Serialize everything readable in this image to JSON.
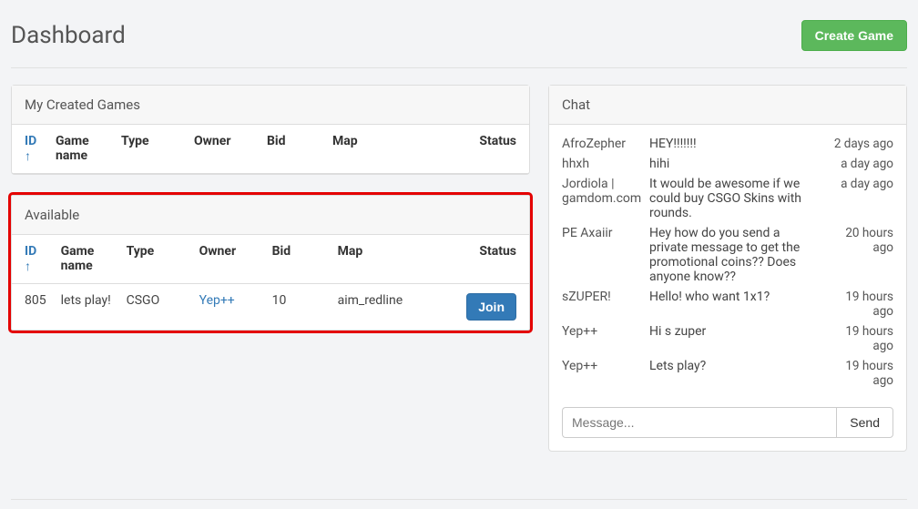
{
  "header": {
    "title": "Dashboard",
    "create_button": "Create Game"
  },
  "my_games_panel": {
    "heading": "My Created Games",
    "columns": {
      "id": "ID ↑",
      "game_name": "Game name",
      "type": "Type",
      "owner": "Owner",
      "bid": "Bid",
      "map": "Map",
      "status": "Status"
    }
  },
  "available_panel": {
    "heading": "Available",
    "columns": {
      "id": "ID ↑",
      "game_name": "Game name",
      "type": "Type",
      "owner": "Owner",
      "bid": "Bid",
      "map": "Map",
      "status": "Status"
    },
    "rows": [
      {
        "id": "805",
        "game_name": "lets play!",
        "type": "CSGO",
        "owner": "Yep++",
        "bid": "10",
        "map": "aim_redline",
        "action_label": "Join"
      }
    ]
  },
  "chat_panel": {
    "heading": "Chat",
    "messages": [
      {
        "user": "AfroZepher",
        "text": "HEY!!!!!!!",
        "time": "2 days ago"
      },
      {
        "user": "hhxh",
        "text": "hihi",
        "time": "a day ago"
      },
      {
        "user": "Jordiola | gamdom.com",
        "text": "It would be awesome if we could buy CSGO Skins with rounds.",
        "time": "a day ago"
      },
      {
        "user": "PE Axaiir",
        "text": "Hey how do you send a private message to get the promotional coins?? Does anyone know??",
        "time": "20 hours ago"
      },
      {
        "user": "sZUPER!",
        "text": "Hello! who want 1x1?",
        "time": "19 hours ago"
      },
      {
        "user": "Yep++",
        "text": "Hi s zuper",
        "time": "19 hours ago"
      },
      {
        "user": "Yep++",
        "text": "Lets play?",
        "time": "19 hours ago"
      }
    ],
    "input_placeholder": "Message...",
    "send_label": "Send"
  }
}
